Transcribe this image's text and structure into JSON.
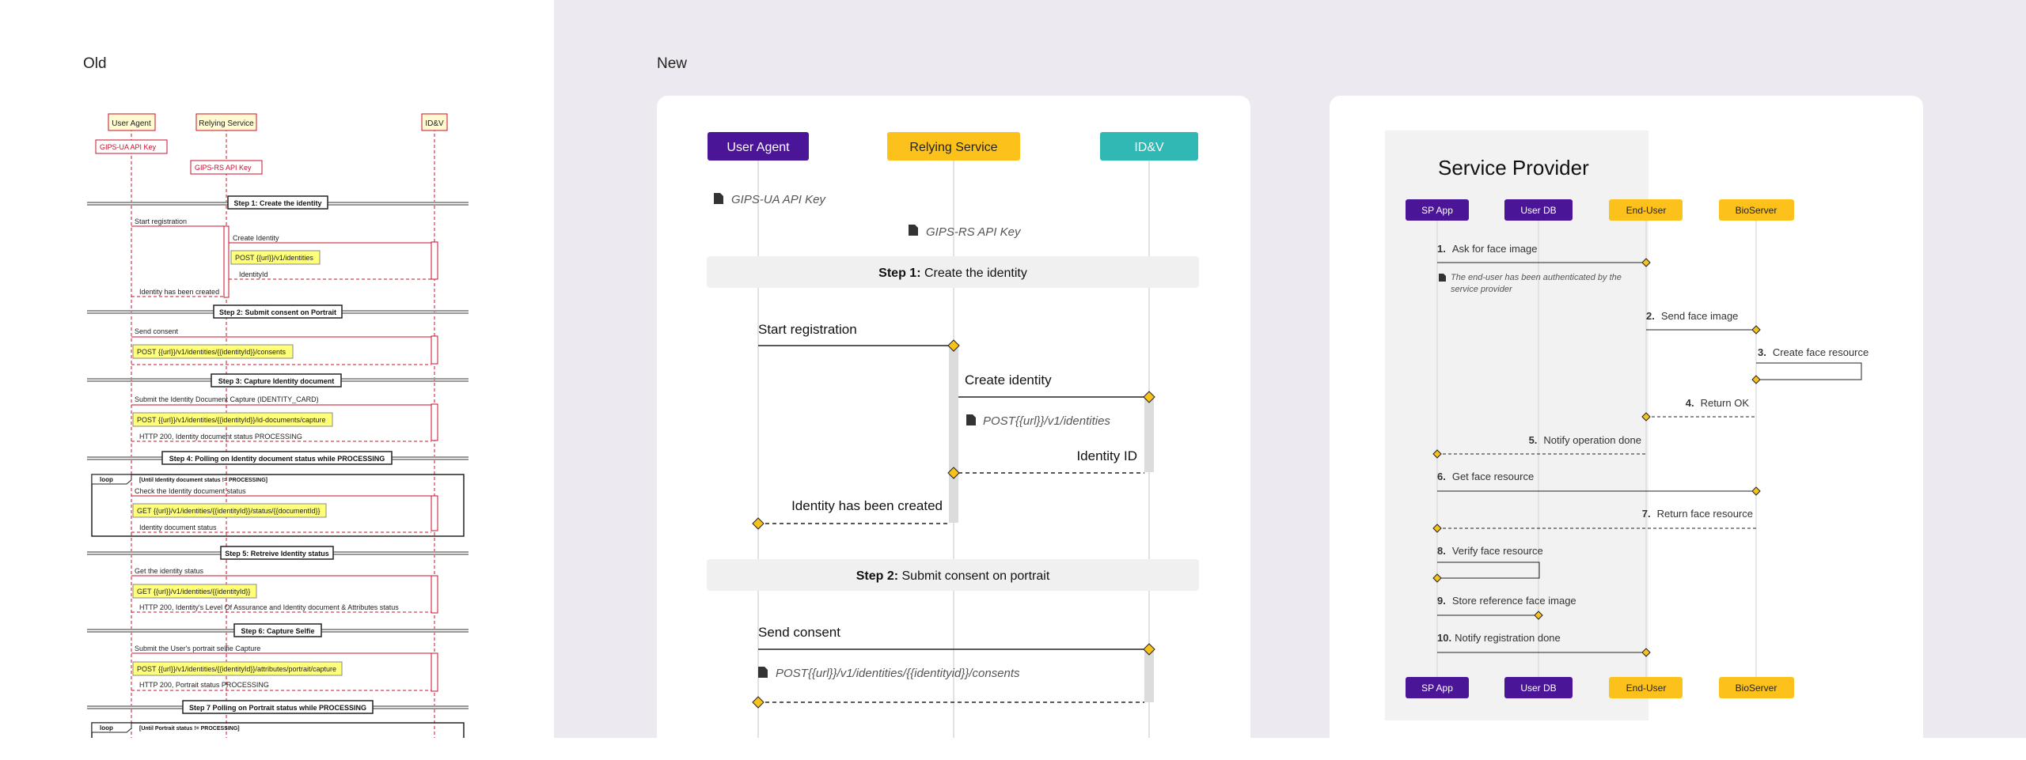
{
  "labels": {
    "old": "Old",
    "new": "New"
  },
  "old": {
    "participants": [
      "User Agent",
      "Relying Service",
      "ID&V"
    ],
    "notes": [
      "GIPS-UA API Key",
      "GIPS-RS API Key"
    ],
    "steps": [
      "Step 1: Create the identity",
      "Step 2: Submit consent on Portrait",
      "Step 3: Capture Identity document",
      "Step 4: Polling on Identity document status while PROCESSING",
      "Step 5: Retreive Identity status",
      "Step 6: Capture Selfie",
      "Step 7 Polling on Portrait status while PROCESSING"
    ],
    "loop_label": "loop",
    "loop_conditions": [
      "[Until Identity document status != PROCESSING]",
      "[Until Portrait status != PROCESSING]"
    ],
    "messages": [
      "Start registration",
      "Create Identity",
      "POST {{url}}/v1/identities",
      "IdentityId",
      "Identity has been created",
      "Send consent",
      "POST {{url}}/v1/identities/{{identityId}}/consents",
      "Submit the Identity Document Capture (IDENTITY_CARD)",
      "POST {{url}}/v1/identities/{{identityId}}/id-documents/capture",
      "HTTP 200, Identity document status PROCESSING",
      "Check the Identity document status",
      "GET {{url}}/v1/identities/{{identityId}}/status/{{documentId}}",
      "Identity document status",
      "Get the identity status",
      "GET {{url}}/v1/identities/{{identityId}}",
      "HTTP 200, Identity's Level Of Assurance and Identity document & Attributes status",
      "Submit the User's portrait selfie Capture",
      "POST {{url}}/v1/identities/{{identityId}}/attributes/portrait/capture",
      "HTTP 200, Portrait status PROCESSING"
    ]
  },
  "new1": {
    "participants": [
      "User Agent",
      "Relying Service",
      "ID&V"
    ],
    "notes": [
      "GIPS-UA API Key",
      "GIPS-RS API Key"
    ],
    "step1_prefix": "Step 1:",
    "step1_text": " Create the identity",
    "step2_prefix": "Step 2:",
    "step2_text": " Submit consent on portrait",
    "messages": [
      "Start registration",
      "Create identity",
      "POST{{url}}/v1/identities",
      "Identity ID",
      "Identity has been created",
      "Send consent",
      "POST{{url}}/v1/identities/{{identityid}}/consents"
    ]
  },
  "new2": {
    "title": "Service Provider",
    "participants": [
      "SP App",
      "User DB",
      "End-User",
      "BioServer"
    ],
    "note": [
      "The end-user has been authenticated by the",
      "service provider"
    ],
    "messages": [
      {
        "n": "1.",
        "t": "Ask for face image"
      },
      {
        "n": "2.",
        "t": "Send face image"
      },
      {
        "n": "3.",
        "t": "Create face resource"
      },
      {
        "n": "4.",
        "t": "Return OK"
      },
      {
        "n": "5.",
        "t": "Notify operation done"
      },
      {
        "n": "6.",
        "t": "Get face resource"
      },
      {
        "n": "7.",
        "t": "Return face resource"
      },
      {
        "n": "8.",
        "t": "Verify face resource"
      },
      {
        "n": "9.",
        "t": "Store reference face image"
      },
      {
        "n": "10.",
        "t": "Notify registration done"
      }
    ]
  },
  "colors": {
    "purple": "#4a1597",
    "yellow": "#fcc21b",
    "teal": "#2fb8b4",
    "old_red": "#c8102e",
    "note_yellow": "#ffff7a",
    "diamond": "#f6c21b"
  }
}
